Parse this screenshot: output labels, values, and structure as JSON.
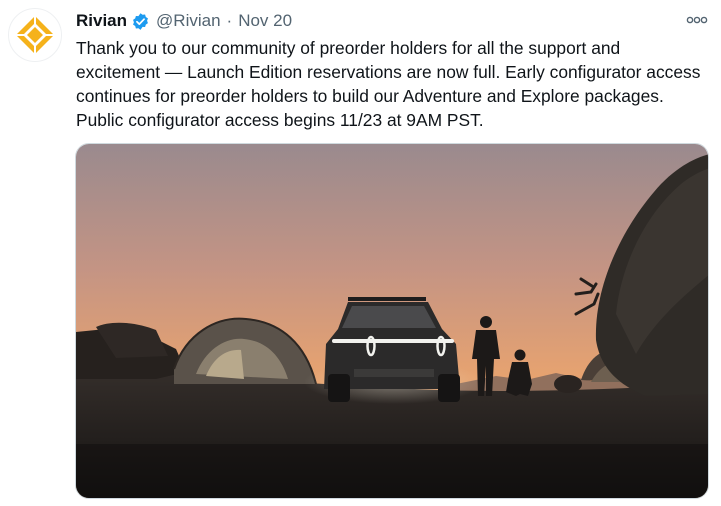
{
  "tweet": {
    "author_name": "Rivian",
    "handle": "@Rivian",
    "separator": "·",
    "date": "Nov 20",
    "text": "Thank you to our community of preorder holders for all the support and excitement — Launch Edition reservations are now full. Early configurator access continues for preorder holders to build our Adventure and Explore packages. Public configurator access begins 11/23 at 9AM PST.",
    "icons": {
      "avatar": "rivian-logo-icon",
      "verified": "verified-badge-icon",
      "more": "more-options-icon"
    },
    "colors": {
      "brand_yellow": "#f5b21b",
      "verified_blue": "#1d9bf0",
      "muted_text": "#536471"
    }
  }
}
